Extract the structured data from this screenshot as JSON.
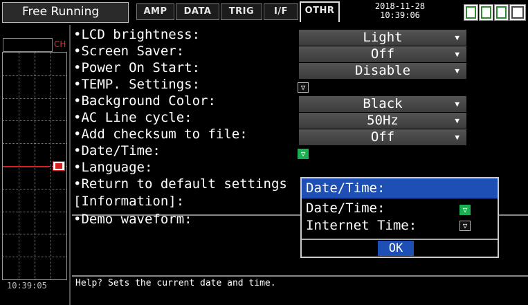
{
  "header": {
    "mode": "Free Running",
    "tabs": [
      {
        "label": "AMP"
      },
      {
        "label": "DATA"
      },
      {
        "label": "TRIG"
      },
      {
        "label": "I/F"
      },
      {
        "label": "OTHR"
      }
    ],
    "date": "2018-11-28",
    "time": "10:39:06",
    "status_icons": [
      "memory-icon",
      "memory2-icon",
      "battery-icon",
      "lock-icon"
    ]
  },
  "monitor": {
    "channel_label": "CH",
    "time": "10:39:05"
  },
  "settings": [
    {
      "label": "•LCD brightness:",
      "value": "Light",
      "type": "dropdown"
    },
    {
      "label": "•Screen Saver:",
      "value": "Off",
      "type": "dropdown"
    },
    {
      "label": "•Power On Start:",
      "value": "Disable",
      "type": "dropdown"
    },
    {
      "label": "•TEMP. Settings:",
      "type": "submenu"
    },
    {
      "label": "•Background Color:",
      "value": "Black",
      "type": "dropdown"
    },
    {
      "label": "•AC Line cycle:",
      "value": "50Hz",
      "type": "dropdown"
    },
    {
      "label": "•Add checksum to file:",
      "value": "Off",
      "type": "dropdown"
    },
    {
      "label": "•Date/Time:",
      "type": "submenu",
      "active": true
    },
    {
      "label": "•Language:",
      "type": "hidden"
    },
    {
      "label": "•Return to default settings",
      "type": "hidden"
    },
    {
      "label": "[Information]:",
      "type": "hidden"
    },
    {
      "label": "•Demo waveform:",
      "type": "hidden"
    }
  ],
  "popup": {
    "title": "Date/Time:",
    "items": [
      {
        "label": "Date/Time:"
      },
      {
        "label": "Internet Time:"
      }
    ],
    "ok_label": "OK"
  },
  "help_text": "Help?  Sets the current date and time.",
  "colors": {
    "accent": "#1e4fb5",
    "active_submenu": "#18b050",
    "channel": "#d82020"
  }
}
